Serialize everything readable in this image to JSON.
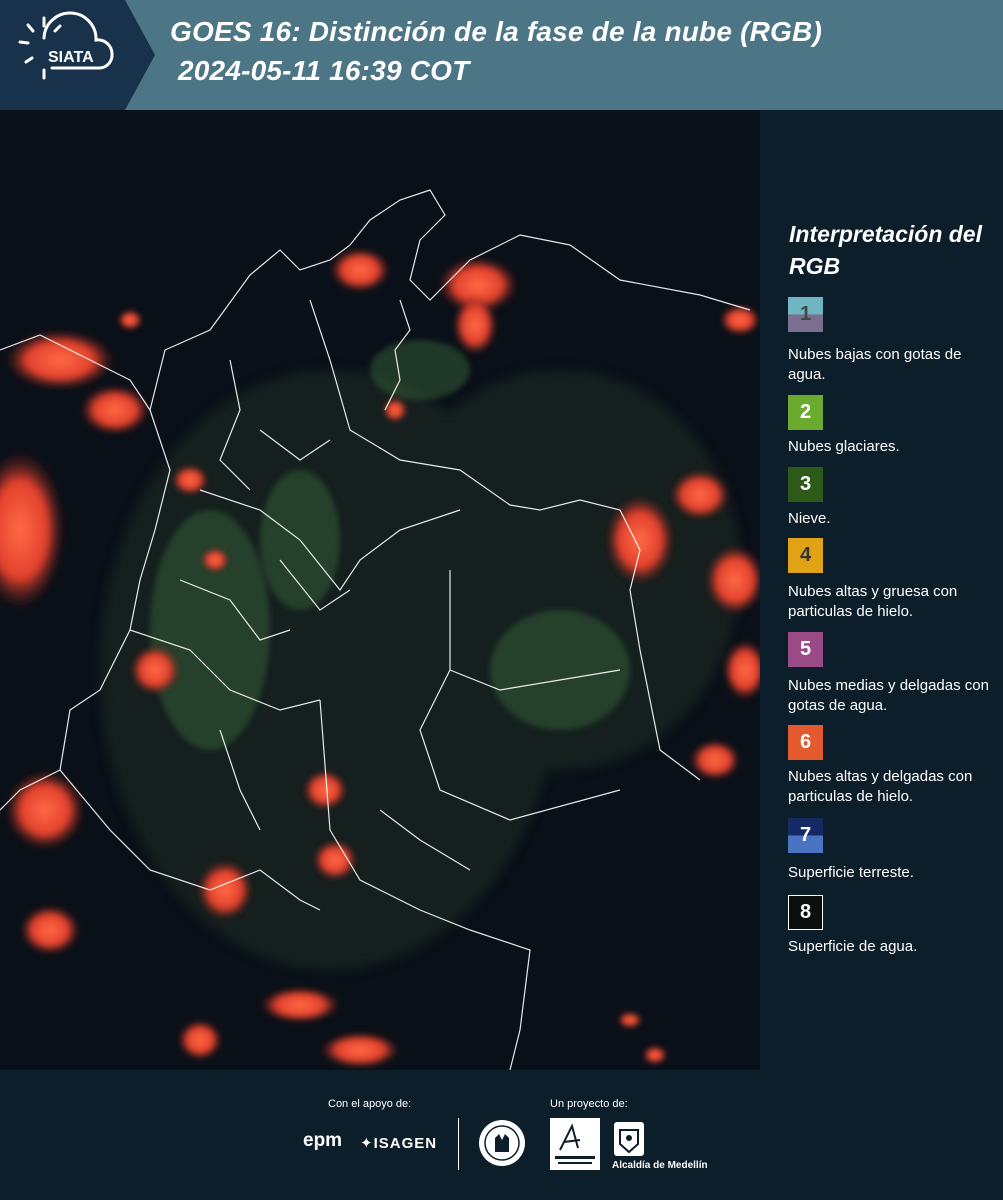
{
  "header": {
    "logo_text": "SIATA",
    "title_line1": "GOES 16: Distinción de la fase de la nube (RGB)",
    "title_line2": "2024-05-11 16:39 COT"
  },
  "legend": {
    "title": "Interpretación del RGB",
    "items": [
      {
        "number": "1",
        "colors": [
          "#6fb6c2",
          "#7a6f8e"
        ],
        "text": "Nubes bajas con gotas de agua."
      },
      {
        "number": "2",
        "colors": [
          "#6aaa2e"
        ],
        "text": "Nubes glaciares."
      },
      {
        "number": "3",
        "colors": [
          "#2d5a18"
        ],
        "text": "Nieve."
      },
      {
        "number": "4",
        "colors": [
          "#e0a316"
        ],
        "text": "Nubes altas y gruesa con particulas de hielo."
      },
      {
        "number": "5",
        "colors": [
          "#9a4b86"
        ],
        "text": "Nubes medias y delgadas con gotas de agua."
      },
      {
        "number": "6",
        "colors": [
          "#e25a2e"
        ],
        "text": "Nubes altas y delgadas con particulas de hielo."
      },
      {
        "number": "7",
        "colors": [
          "#152a64",
          "#4a73c2"
        ],
        "text": "Superficie terreste."
      },
      {
        "number": "8",
        "colors": [
          "#0b0f0c"
        ],
        "text": "Superficie de agua."
      }
    ]
  },
  "footer": {
    "support_caption": "Con el apoyo de:",
    "project_caption": "Un proyecto de:",
    "epm": "epm",
    "isagen": "ISAGEN",
    "alcaldia": "Alcaldía de Medellín"
  },
  "colors": {
    "header_bg": "#4c7585",
    "panel_bg": "#0d1e2b",
    "cloud_ice": "#ff5a3a"
  }
}
